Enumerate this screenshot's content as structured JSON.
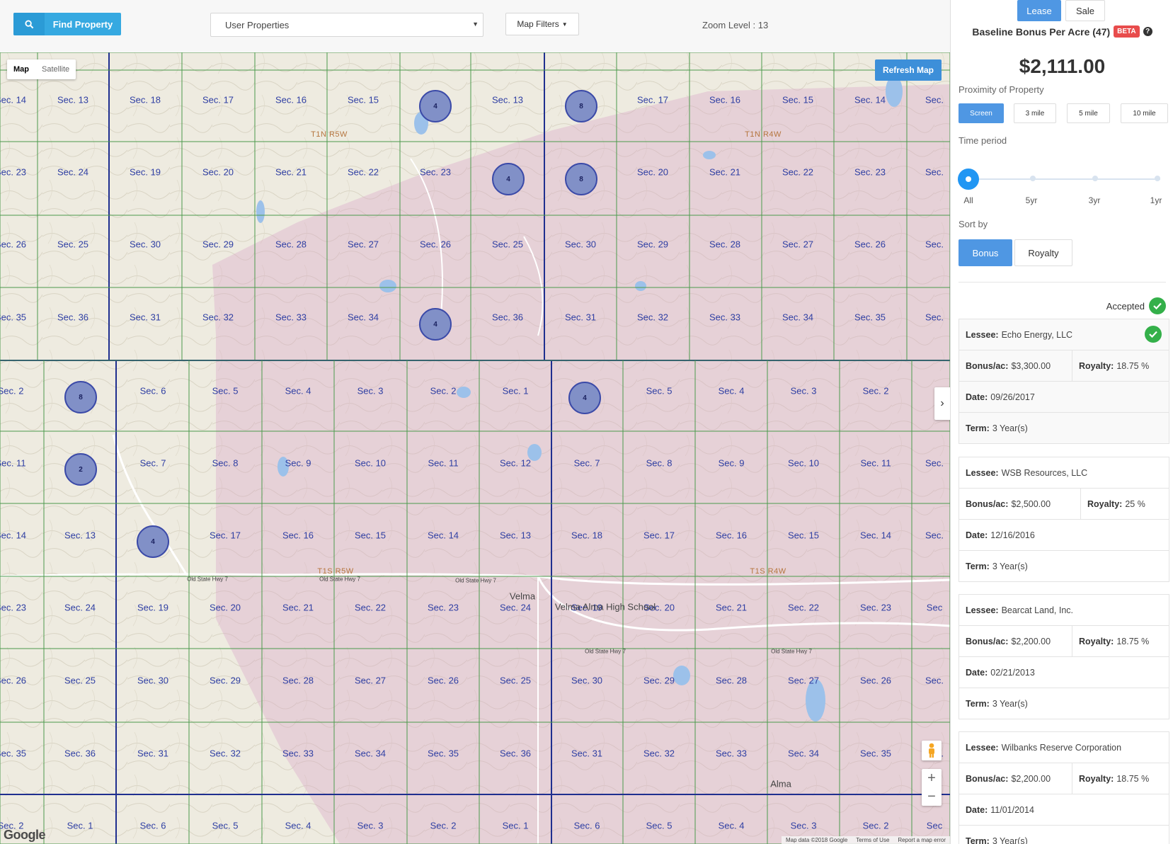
{
  "topbar": {
    "find_property": "Find Property",
    "select_value": "User Properties",
    "map_filters": "Map Filters",
    "zoom_level": "Zoom Level : 13"
  },
  "map": {
    "type_map": "Map",
    "type_satellite": "Satellite",
    "refresh": "Refresh Map",
    "attribution": [
      "Map data ©2018 Google",
      "Terms of Use",
      "Report a map error"
    ],
    "google": "Google",
    "sections": [
      [
        "14",
        "13",
        "18",
        "17",
        "16",
        "15",
        "",
        "13",
        "",
        "17",
        "16",
        "15",
        "14",
        "Sec."
      ],
      [
        "23",
        "24",
        "19",
        "20",
        "21",
        "22",
        "23",
        "",
        "",
        "20",
        "21",
        "22",
        "23",
        "Sec."
      ],
      [
        "26",
        "25",
        "30",
        "29",
        "28",
        "27",
        "26",
        "25",
        "30",
        "29",
        "28",
        "27",
        "26",
        "Sec."
      ],
      [
        "35",
        "36",
        "31",
        "32",
        "33",
        "34",
        "",
        "36",
        "31",
        "32",
        "33",
        "34",
        "35",
        "Sec."
      ],
      [
        "2",
        "",
        "6",
        "5",
        "4",
        "3",
        "2",
        "1",
        "",
        "5",
        "4",
        "3",
        "2",
        ""
      ],
      [
        "11",
        "",
        "7",
        "8",
        "9",
        "10",
        "11",
        "12",
        "7",
        "8",
        "9",
        "10",
        "11",
        "Sec."
      ],
      [
        "14",
        "13",
        "",
        "17",
        "16",
        "15",
        "14",
        "13",
        "18",
        "17",
        "16",
        "15",
        "14",
        "Sec."
      ],
      [
        "23",
        "24",
        "19",
        "20",
        "21",
        "22",
        "23",
        "24",
        "19",
        "20",
        "21",
        "22",
        "23",
        "Sec"
      ],
      [
        "26",
        "25",
        "30",
        "29",
        "28",
        "27",
        "26",
        "25",
        "30",
        "29",
        "28",
        "27",
        "26",
        "Sec."
      ],
      [
        "35",
        "36",
        "31",
        "32",
        "33",
        "34",
        "35",
        "36",
        "31",
        "32",
        "33",
        "34",
        "35",
        "Sec."
      ],
      [
        "2",
        "1",
        "6",
        "5",
        "4",
        "3",
        "2",
        "1",
        "6",
        "5",
        "4",
        "3",
        "2",
        "Sec"
      ]
    ],
    "township_labels": [
      "T1N R5W",
      "T1N R4W",
      "T1S R5W",
      "T1S R4W"
    ],
    "places": [
      "Velma",
      "Velma Alma High School",
      "Alma"
    ],
    "road_labels": [
      "Old State Hwy 7",
      "Old State Hwy 7",
      "Old State Hwy 7",
      "Old State Hwy 7",
      "Old State Hwy 7"
    ],
    "clusters": [
      "4",
      "8",
      "4",
      "8",
      "4",
      "8",
      "4",
      "2",
      "4"
    ]
  },
  "panel": {
    "lease": "Lease",
    "sale": "Sale",
    "title": "Baseline Bonus Per Acre (47)",
    "beta": "BETA",
    "help": "?",
    "value": "$2,111.00",
    "proximity_label": "Proximity of Property",
    "proximity": [
      "Screen",
      "3 mile",
      "5 mile",
      "10 mile"
    ],
    "time_label": "Time period",
    "time_ticks": [
      "All",
      "5yr",
      "3yr",
      "1yr"
    ],
    "sort_label": "Sort by",
    "sort": [
      "Bonus",
      "Royalty"
    ],
    "accepted": "Accepted",
    "leases": [
      {
        "lessee": "Echo Energy, LLC",
        "bonus": "$3,300.00",
        "royalty": "18.75 %",
        "date": "09/26/2017",
        "term": "3 Year(s)"
      },
      {
        "lessee": "WSB Resources, LLC",
        "bonus": "$2,500.00",
        "royalty": "25 %",
        "date": "12/16/2016",
        "term": "3 Year(s)"
      },
      {
        "lessee": "Bearcat Land, Inc.",
        "bonus": "$2,200.00",
        "royalty": "18.75 %",
        "date": "02/21/2013",
        "term": "3 Year(s)"
      },
      {
        "lessee": "Wilbanks Reserve Corporation",
        "bonus": "$2,200.00",
        "royalty": "18.75 %",
        "date": "11/01/2014",
        "term": "3 Year(s)"
      }
    ],
    "labels": {
      "lessee": "Lessee:",
      "bonus": "Bonus/ac:",
      "royalty": "Royalty:",
      "date": "Date:",
      "term": "Term:"
    }
  }
}
